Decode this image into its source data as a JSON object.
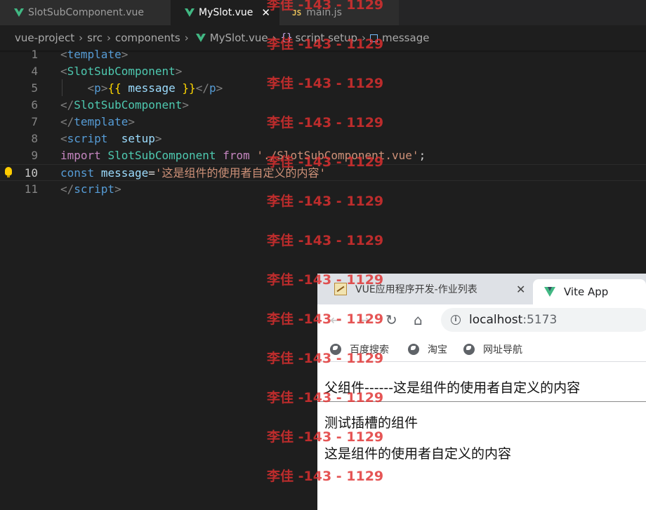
{
  "editor": {
    "tabs": [
      {
        "label": "SlotSubComponent.vue",
        "icon": "vue-icon"
      },
      {
        "label": "MySlot.vue",
        "icon": "vue-icon",
        "active": true
      },
      {
        "label": "main.js",
        "icon": "js-icon",
        "badge": "JS"
      }
    ],
    "breadcrumb": [
      "vue-project",
      "src",
      "components",
      "MySlot.vue",
      "script setup",
      "message"
    ],
    "lines": [
      {
        "num": "1",
        "tokens": [
          [
            "k1",
            "<"
          ],
          [
            "tag",
            "template"
          ],
          [
            "k1",
            ">"
          ]
        ]
      },
      {
        "num": "4",
        "tokens": [
          [
            "k1",
            "<"
          ],
          [
            "cmp",
            "SlotSubComponent"
          ],
          [
            "k1",
            ">"
          ]
        ]
      },
      {
        "num": "5",
        "tokens": [
          [
            "",
            "    "
          ],
          [
            "k1",
            "<"
          ],
          [
            "tag",
            "p"
          ],
          [
            "k1",
            ">"
          ],
          [
            "brk",
            "{{"
          ],
          [
            "var",
            " message "
          ],
          [
            "brk",
            "}}"
          ],
          [
            "k1",
            "</"
          ],
          [
            "tag",
            "p"
          ],
          [
            "k1",
            ">"
          ]
        ]
      },
      {
        "num": "6",
        "tokens": [
          [
            "k1",
            "</"
          ],
          [
            "cmp",
            "SlotSubComponent"
          ],
          [
            "k1",
            ">"
          ]
        ]
      },
      {
        "num": "7",
        "tokens": [
          [
            "k1",
            "</"
          ],
          [
            "tag",
            "template"
          ],
          [
            "k1",
            ">"
          ]
        ]
      },
      {
        "num": "8",
        "tokens": [
          [
            "k1",
            "<"
          ],
          [
            "tag",
            "script"
          ],
          [
            "",
            "  "
          ],
          [
            "var",
            "setup"
          ],
          [
            "k1",
            ">"
          ]
        ]
      },
      {
        "num": "9",
        "tokens": [
          [
            "kw",
            "import"
          ],
          [
            "",
            " "
          ],
          [
            "cmp",
            "SlotSubComponent"
          ],
          [
            "",
            " "
          ],
          [
            "kw",
            "from"
          ],
          [
            "",
            " "
          ],
          [
            "str",
            "'./SlotSubComponent.vue'"
          ],
          [
            "",
            ";"
          ]
        ]
      },
      {
        "num": "10",
        "current": true,
        "tokens": [
          [
            "decl",
            "const"
          ],
          [
            "",
            " "
          ],
          [
            "var",
            "message"
          ],
          [
            "",
            "="
          ],
          [
            "str",
            "'这是组件的使用者自定义的内容'"
          ]
        ]
      },
      {
        "num": "11",
        "tokens": [
          [
            "k1",
            "</"
          ],
          [
            "tag",
            "script"
          ],
          [
            "k1",
            ">"
          ]
        ]
      }
    ]
  },
  "watermark": "李佳 -143 - 1129",
  "browser": {
    "tabs": [
      {
        "label": "VUE应用程序开发-作业列表"
      },
      {
        "label": "Vite App",
        "active": true
      }
    ],
    "url_host": "localhost",
    "url_port": ":5173",
    "bookmarks": [
      "百度搜索",
      "淘宝",
      "网址导航"
    ],
    "page": {
      "parent_heading": "父组件------这是组件的使用者自定义的内容",
      "line1": "测试插槽的组件",
      "line2": "这是组件的使用者自定义的内容"
    }
  }
}
